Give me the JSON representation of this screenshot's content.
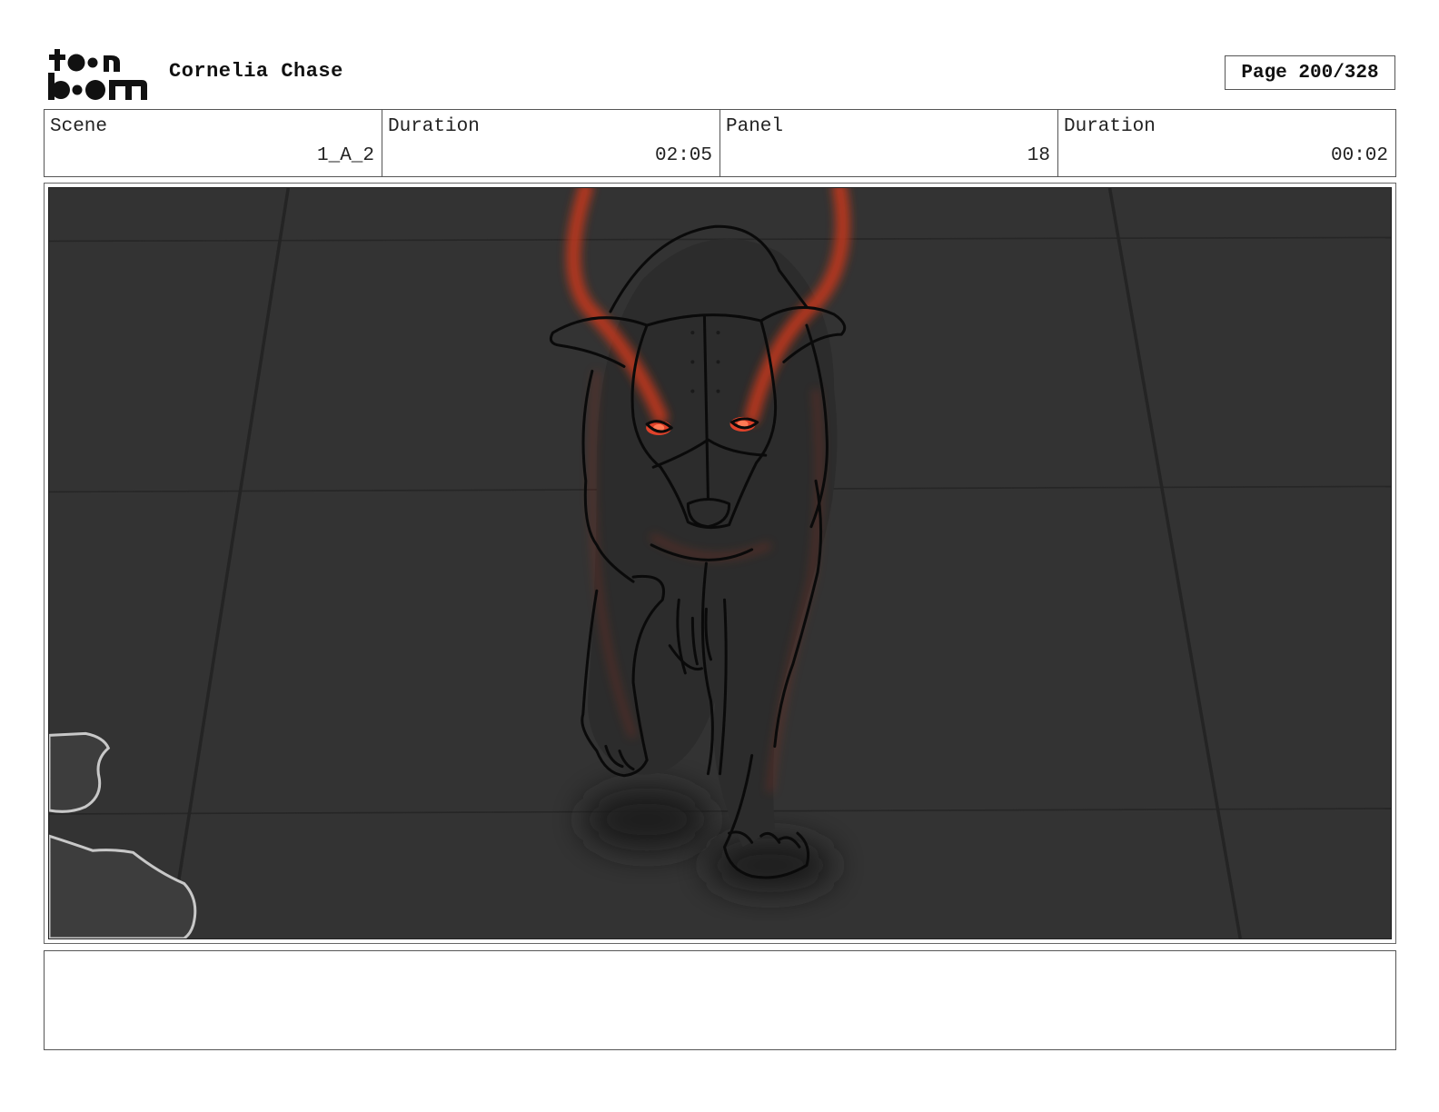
{
  "header": {
    "logo_icon": "toonboom-logo-icon",
    "project_title": "Cornelia Chase",
    "page_label": "Page 200/328"
  },
  "info": [
    {
      "label": "Scene",
      "value": "1_A_2"
    },
    {
      "label": "Duration",
      "value": "02:05"
    },
    {
      "label": "Panel",
      "value": "18"
    },
    {
      "label": "Duration",
      "value": "00:02"
    }
  ],
  "panel": {
    "image_icon": "storyboard-panel-drawing",
    "colors": {
      "floor": "#323232",
      "glow": "#c0391b",
      "line": "#0a0a0a",
      "outline": "#c8c8c8"
    }
  },
  "notes": {
    "text": ""
  }
}
